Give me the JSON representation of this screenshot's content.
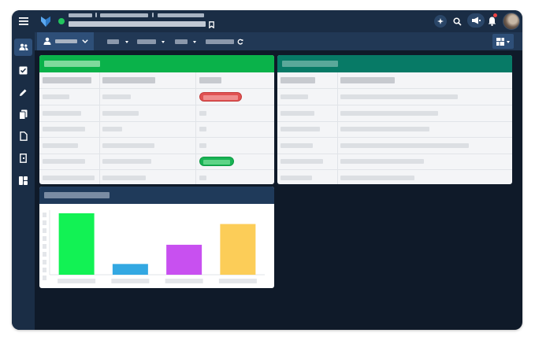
{
  "colors": {
    "app_background": "#0f1a29",
    "topbar": "#1a2d45",
    "toolbar": "#213855",
    "panel1_header": "#0ab24a",
    "panel2_header": "#077a66",
    "panel3_header": "#1f3a5a",
    "status_red": "#e05252",
    "status_green": "#18b354",
    "online_dot": "#22c55e",
    "notification_dot": "#ef4444"
  },
  "icons": {
    "menu": "hamburger-menu-icon",
    "logo": "logo-icon",
    "bookmark": "bookmark-icon",
    "assistant": "assistant-icon",
    "search": "search-icon",
    "announcements": "megaphone-icon",
    "notifications": "bell-icon",
    "user_avatar": "avatar",
    "layout": "dashboard-layout-icon",
    "sidebar": [
      "users-icon",
      "checkbox-icon",
      "pencil-icon",
      "documents-icon",
      "file-icon",
      "exit-icon",
      "widgets-icon"
    ]
  },
  "chart_data": {
    "type": "bar",
    "categories": [
      "",
      "",
      "",
      ""
    ],
    "values": [
      80,
      14,
      39,
      66
    ],
    "ylim": [
      0,
      84
    ],
    "colors": [
      "#12f254",
      "#33a8e2",
      "#c850f0",
      "#fccd58"
    ],
    "grid": false
  }
}
